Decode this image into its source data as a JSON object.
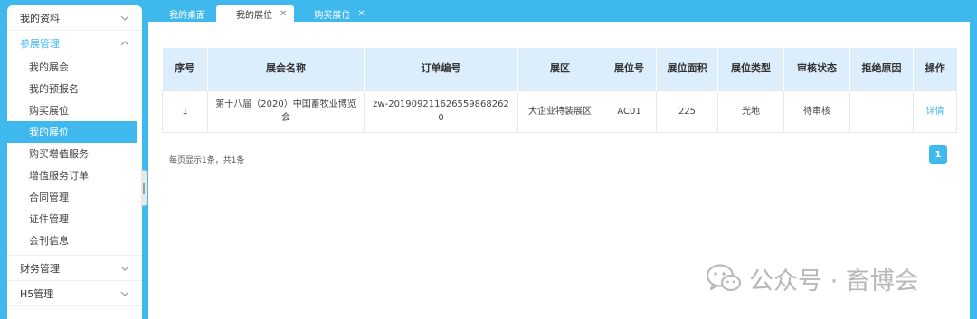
{
  "sidebar": {
    "groups": [
      {
        "label": "我的资料",
        "open": false
      },
      {
        "label": "参展管理",
        "open": true,
        "items": [
          "我的展会",
          "我的预报名",
          "购买展位",
          "我的展位",
          "购买增值服务",
          "增值服务订单",
          "合同管理",
          "证件管理",
          "会刊信息"
        ],
        "active_item": "我的展位"
      },
      {
        "label": "财务管理",
        "open": false
      },
      {
        "label": "H5管理",
        "open": false
      }
    ]
  },
  "tabs": [
    {
      "label": "我的桌面",
      "closable": false,
      "active": false
    },
    {
      "label": "我的展位",
      "closable": true,
      "active": true
    },
    {
      "label": "购买展位",
      "closable": true,
      "active": false
    }
  ],
  "table": {
    "headers": [
      "序号",
      "展会名称",
      "订单编号",
      "展区",
      "展位号",
      "展位面积",
      "展位类型",
      "审核状态",
      "拒绝原因",
      "操作"
    ],
    "rows": [
      [
        "1",
        "第十八届（2020）中国畜牧业博览会",
        "zw-2019092116265598682620",
        "大企业特装展区",
        "AC01",
        "225",
        "光地",
        "待审核",
        "",
        "详情"
      ]
    ]
  },
  "pagination": {
    "summary": "每页显示1条，共1条",
    "current_page": "1"
  },
  "watermark": {
    "text": "公众号 · 畜博会",
    "icon": "wechat-icon"
  },
  "colors": {
    "accent": "#3fb8ee",
    "header_bg": "#dceefc"
  }
}
